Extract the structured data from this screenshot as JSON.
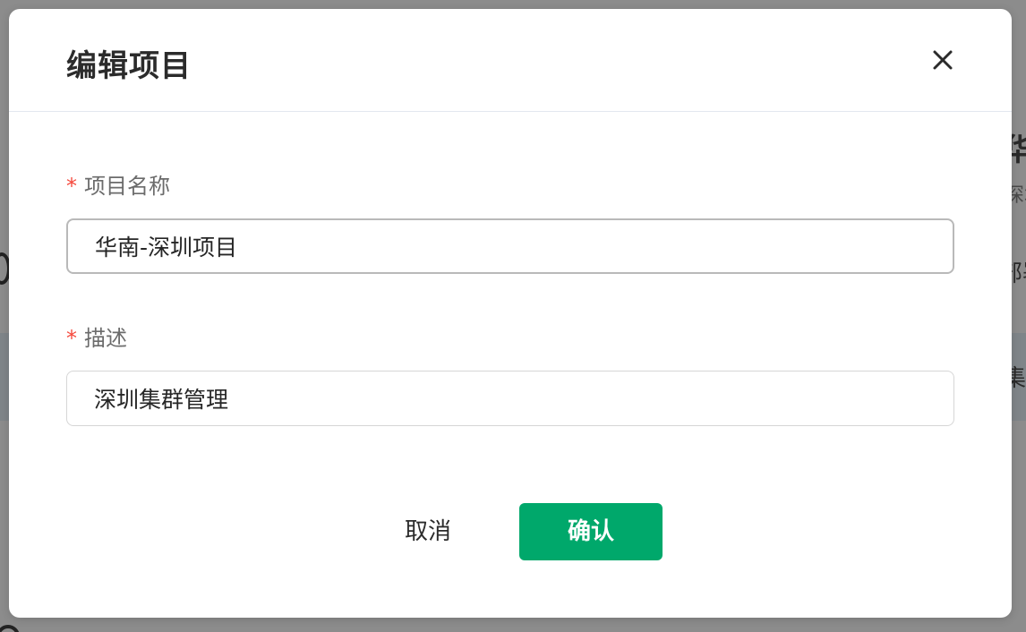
{
  "modal": {
    "title": "编辑项目",
    "close_icon": "close-icon",
    "fields": [
      {
        "required_mark": "*",
        "label": "项目名称",
        "value": "华南-深圳项目"
      },
      {
        "required_mark": "*",
        "label": "描述",
        "value": "深圳集群管理"
      }
    ],
    "cancel_label": "取消",
    "confirm_label": "确认"
  },
  "background": {
    "fragments": [
      "华南",
      "深圳",
      "部署",
      "集群"
    ]
  },
  "colors": {
    "accent": "#00a86b",
    "required": "#f5493d",
    "overlay": "#8c8c8c",
    "divider": "#e3e8ef"
  }
}
